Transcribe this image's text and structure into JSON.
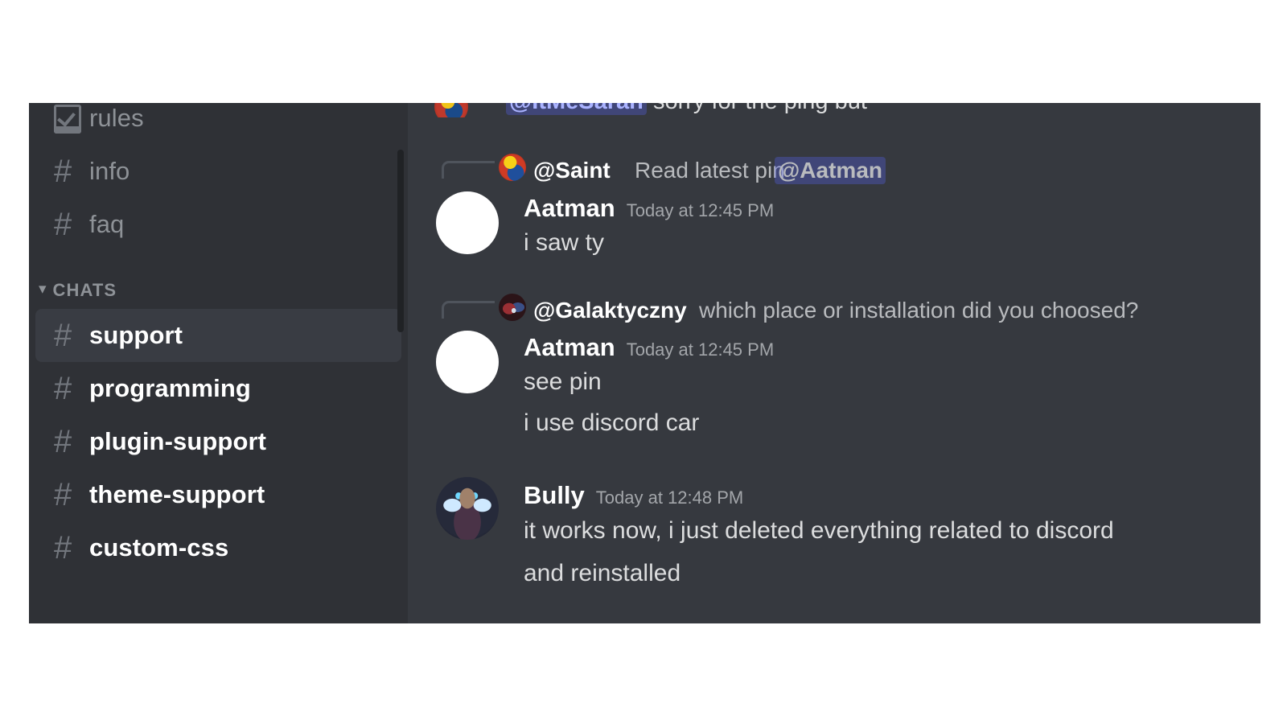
{
  "app": {
    "name": "Discord",
    "theme": "dark"
  },
  "colors": {
    "sidebar_bg": "#2f3136",
    "chat_bg": "#36393f",
    "active_channel_bg": "#393c43",
    "channel_text": "#8e9297",
    "channel_text_active": "#ffffff",
    "message_text": "#dcddde",
    "timestamp_text": "#a3a6aa",
    "mention_bg": "#5865f2",
    "mention_text": "#aab3ff",
    "scrollbar": "#202225",
    "reply_spine": "#4f545c"
  },
  "sidebar": {
    "scrollbar": {
      "name": "channel-list-scrollbar"
    },
    "top_channels": [
      {
        "icon": "rules-book-icon",
        "label": "rules",
        "active": false,
        "bright": false
      },
      {
        "icon": "hash-icon",
        "label": "info",
        "active": false,
        "bright": false
      },
      {
        "icon": "hash-icon",
        "label": "faq",
        "active": false,
        "bright": false
      }
    ],
    "category": {
      "label": "CHATS",
      "collapse_icon": "chevron-down-icon",
      "expanded": true
    },
    "chat_channels": [
      {
        "icon": "hash-icon",
        "label": "support",
        "active": true,
        "bright": true
      },
      {
        "icon": "hash-icon",
        "label": "programming",
        "active": false,
        "bright": true
      },
      {
        "icon": "hash-icon",
        "label": "plugin-support",
        "active": false,
        "bright": true
      },
      {
        "icon": "hash-icon",
        "label": "theme-support",
        "active": false,
        "bright": true
      },
      {
        "icon": "hash-icon",
        "label": "custom-css",
        "active": false,
        "bright": true
      }
    ]
  },
  "chat": {
    "cutoff_message": {
      "avatar": "saint-avatar",
      "mention": "@ItMeSarah",
      "text": "sorry for the ping but"
    },
    "messages": [
      {
        "reply": {
          "avatar": "saint-avatar",
          "author": "@Saint",
          "text_before": "Read latest pin",
          "mention": "@Aatman"
        },
        "avatar": "blank-avatar",
        "author": "Aatman",
        "timestamp": "Today at 12:45 PM",
        "lines": [
          "i saw ty"
        ]
      },
      {
        "reply": {
          "avatar": "galaktyczny-avatar",
          "author": "@Galaktyczny",
          "text_before": "which place or installation did you choosed?",
          "mention": ""
        },
        "avatar": "blank-avatar",
        "author": "Aatman",
        "timestamp": "Today at 12:45 PM",
        "lines": [
          "see pin",
          "i use discord car"
        ]
      },
      {
        "reply": null,
        "avatar": "bully-avatar",
        "author": "Bully",
        "timestamp": "Today at 12:48 PM",
        "lines": [
          "it works now, i just deleted everything related to discord",
          "and reinstalled"
        ]
      }
    ]
  }
}
